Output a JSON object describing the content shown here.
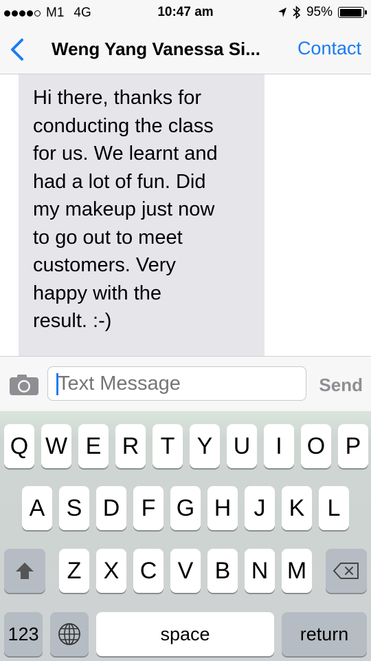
{
  "status_bar": {
    "carrier": "M1",
    "network": "4G",
    "time": "10:47 am",
    "battery": "95%",
    "battery_level": 0.95,
    "signal_bars_filled": 4,
    "signal_bars_total": 5,
    "icons": [
      "location-arrow-icon",
      "bluetooth-icon",
      "battery-icon"
    ]
  },
  "nav": {
    "back_icon": "chevron-left-icon",
    "title": "Weng Yang Vanessa Si...",
    "contact_label": "Contact"
  },
  "conversation": {
    "messages": [
      {
        "direction": "incoming",
        "lines": [
          "Hi there, thanks for",
          "conducting the class",
          "for us. We learnt and",
          "had a lot of fun. Did",
          "my makeup just now",
          "to go out to meet",
          "customers. Very",
          "happy with the",
          "result. :-)"
        ]
      }
    ]
  },
  "composer": {
    "camera_icon": "camera-icon",
    "placeholder": "Text Message",
    "value": "",
    "send_label": "Send"
  },
  "keyboard": {
    "row1": [
      "Q",
      "W",
      "E",
      "R",
      "T",
      "Y",
      "U",
      "I",
      "O",
      "P"
    ],
    "row2": [
      "A",
      "S",
      "D",
      "F",
      "G",
      "H",
      "J",
      "K",
      "L"
    ],
    "row3": [
      "Z",
      "X",
      "C",
      "V",
      "B",
      "N",
      "M"
    ],
    "shift_icon": "shift-arrow-icon",
    "delete_icon": "backspace-icon",
    "numbers_label": "123",
    "globe_icon": "globe-icon",
    "space_label": "space",
    "return_label": "return"
  },
  "colors": {
    "accent": "#1a7cf3",
    "bubble": "#e5e5ea",
    "send_disabled": "#8e8e93"
  }
}
